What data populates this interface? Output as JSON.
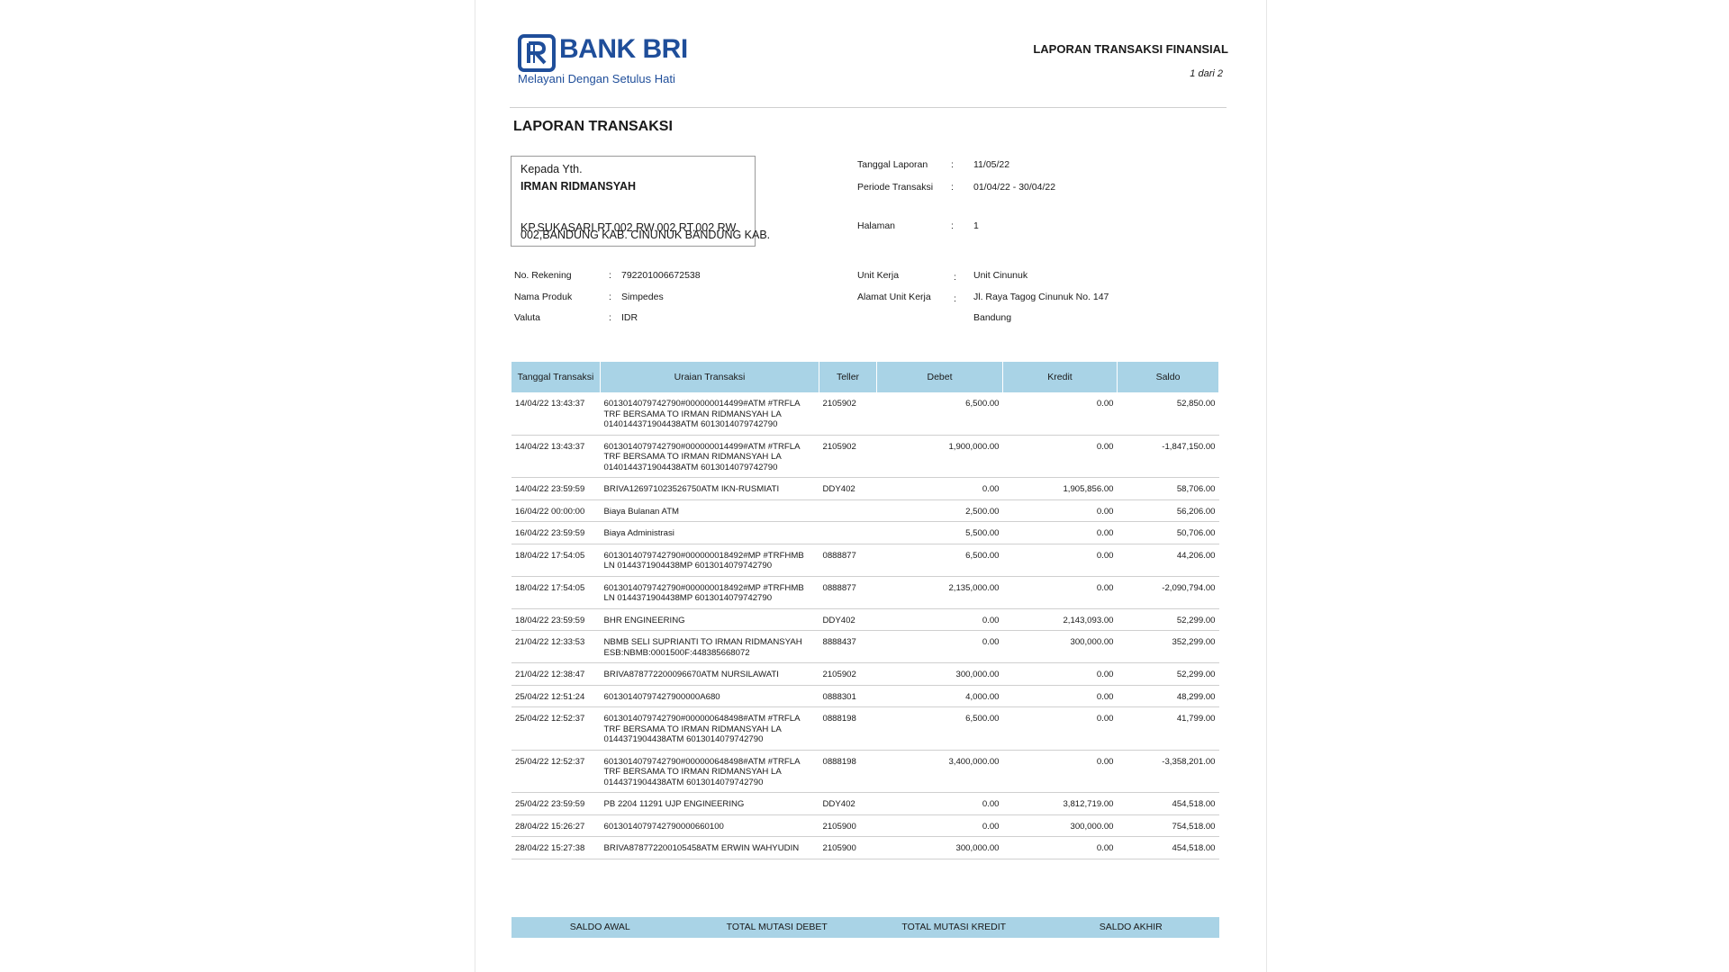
{
  "header": {
    "logo_text": "BANK BRI",
    "logo_tagline": "Melayani Dengan Setulus Hati",
    "report_title": "LAPORAN TRANSAKSI FINANSIAL",
    "page_of": "1 dari 2"
  },
  "section_title": "LAPORAN TRANSAKSI",
  "recipient": {
    "salutation": "Kepada Yth.",
    "name": "IRMAN RIDMANSYAH",
    "address_line1": "KP.SUKASARI RT.002 RW.002  RT.002 RW.",
    "address_line2": "002,BANDUNG KAB. CINUNUK BANDUNG KAB."
  },
  "report_info": {
    "tanggal_label": "Tanggal Laporan",
    "tanggal_value": "11/05/22",
    "periode_label": "Periode Transaksi",
    "periode_value": "01/04/22 - 30/04/22",
    "halaman_label": "Halaman",
    "halaman_value": "1",
    "colon": ":"
  },
  "account": {
    "rekening_label": "No. Rekening",
    "rekening_value": "792201006672538",
    "produk_label": "Nama Produk",
    "produk_value": "Simpedes",
    "valuta_label": "Valuta",
    "valuta_value": "IDR",
    "unit_label": "Unit Kerja",
    "unit_value": "Unit Cinunuk",
    "alamat_label": "Alamat Unit Kerja",
    "alamat_value1": "Jl. Raya Tagog Cinunuk No. 147",
    "alamat_value2": "Bandung"
  },
  "table": {
    "columns": [
      "Tanggal Transaksi",
      "Uraian Transaksi",
      "Teller",
      "Debet",
      "Kredit",
      "Saldo"
    ],
    "rows": [
      [
        "14/04/22 13:43:37",
        "6013014079742790#000000014499#ATM #TRFLA\nTRF BERSAMA TO IRMAN RIDMANSYAH LA\n0140144371904438ATM 6013014079742790",
        "2105902",
        "6,500.00",
        "0.00",
        "52,850.00"
      ],
      [
        "14/04/22 13:43:37",
        "6013014079742790#000000014499#ATM #TRFLA\nTRF BERSAMA TO IRMAN RIDMANSYAH LA\n0140144371904438ATM 6013014079742790",
        "2105902",
        "1,900,000.00",
        "0.00",
        "-1,847,150.00"
      ],
      [
        "14/04/22 23:59:59",
        "BRIVA126971023526750ATM  IKN-RUSMIATI",
        "DDY402",
        "0.00",
        "1,905,856.00",
        "58,706.00"
      ],
      [
        "16/04/22 00:00:00",
        "Biaya Bulanan ATM",
        "",
        "2,500.00",
        "0.00",
        "56,206.00"
      ],
      [
        "16/04/22 23:59:59",
        "Biaya Administrasi",
        "",
        "5,500.00",
        "0.00",
        "50,706.00"
      ],
      [
        "18/04/22 17:54:05",
        "6013014079742790#000000018492#MP #TRFHMB\nLN     0144371904438MP 6013014079742790",
        "0888877",
        "6,500.00",
        "0.00",
        "44,206.00"
      ],
      [
        "18/04/22 17:54:05",
        "6013014079742790#000000018492#MP #TRFHMB\nLN     0144371904438MP 6013014079742790",
        "0888877",
        "2,135,000.00",
        "0.00",
        "-2,090,794.00"
      ],
      [
        "18/04/22 23:59:59",
        "BHR  ENGINEERING",
        "DDY402",
        "0.00",
        "2,143,093.00",
        "52,299.00"
      ],
      [
        "21/04/22 12:33:53",
        "NBMB SELI SUPRIANTI TO IRMAN RIDMANSYAH\nESB:NBMB:0001500F:448385668072",
        "8888437",
        "0.00",
        "300,000.00",
        "352,299.00"
      ],
      [
        "21/04/22 12:38:47",
        "BRIVA878772200096670ATM NURSILAWATI",
        "2105902",
        "300,000.00",
        "0.00",
        "52,299.00"
      ],
      [
        "25/04/22 12:51:24",
        "60130140797427900000A680",
        "0888301",
        "4,000.00",
        "0.00",
        "48,299.00"
      ],
      [
        "25/04/22 12:52:37",
        "6013014079742790#000000648498#ATM #TRFLA\nTRF BERSAMA TO IRMAN RIDMANSYAH LA\n0144371904438ATM 6013014079742790",
        "0888198",
        "6,500.00",
        "0.00",
        "41,799.00"
      ],
      [
        "25/04/22 12:52:37",
        "6013014079742790#000000648498#ATM #TRFLA\nTRF BERSAMA TO IRMAN RIDMANSYAH LA\n0144371904438ATM 6013014079742790",
        "0888198",
        "3,400,000.00",
        "0.00",
        "-3,358,201.00"
      ],
      [
        "25/04/22 23:59:59",
        "PB 2204 11291 UJP ENGINEERING",
        "DDY402",
        "0.00",
        "3,812,719.00",
        "454,518.00"
      ],
      [
        "28/04/22 15:26:27",
        "6013014079742790000660100",
        "2105900",
        "0.00",
        "300,000.00",
        "754,518.00"
      ],
      [
        "28/04/22 15:27:38",
        "BRIVA878772200105458ATM ERWIN WAHYUDIN",
        "2105900",
        "300,000.00",
        "0.00",
        "454,518.00"
      ]
    ]
  },
  "footer": {
    "saldo_awal": "SALDO AWAL",
    "total_debet": "TOTAL MUTASI DEBET",
    "total_kredit": "TOTAL MUTASI KREDIT",
    "saldo_akhir": "SALDO AKHIR"
  },
  "colors": {
    "brand": "#1f4e9a",
    "table_header": "#a9d3e6"
  }
}
